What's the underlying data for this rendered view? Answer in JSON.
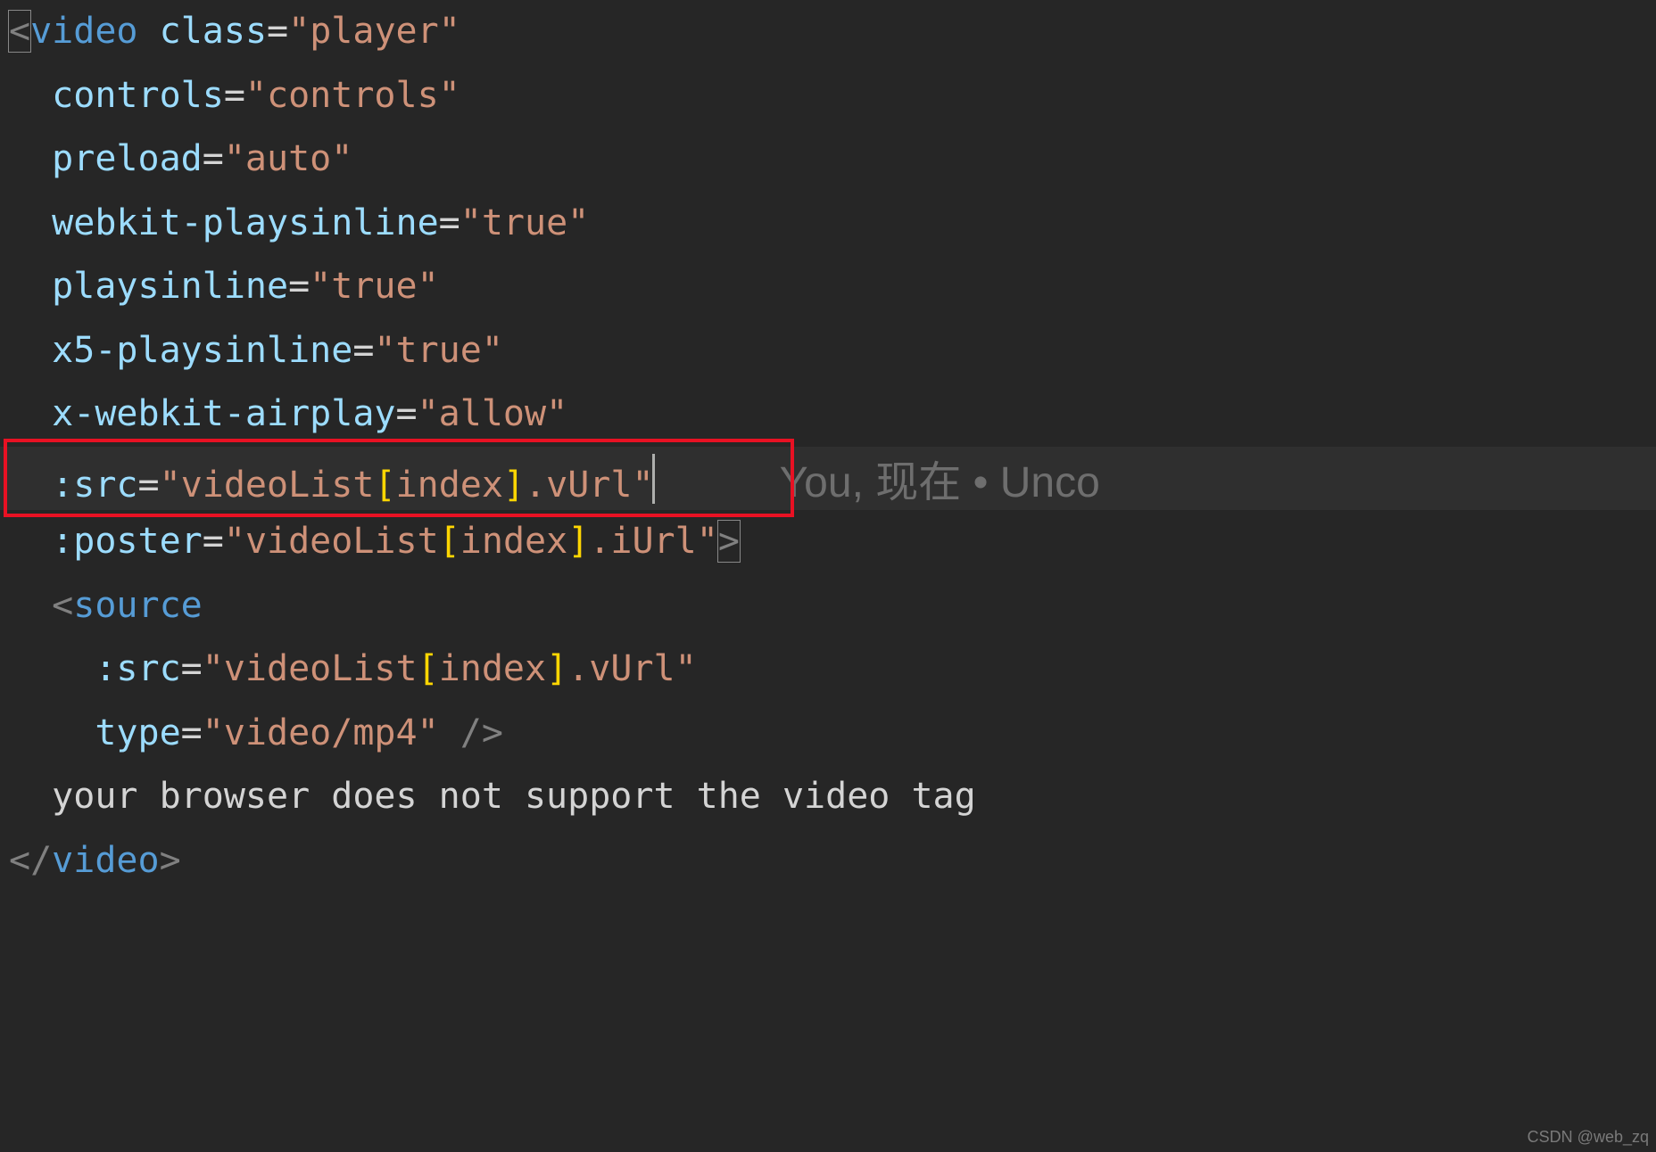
{
  "code": {
    "tag_open": "video",
    "tag_close": "video",
    "source_tag": "source",
    "attrs": {
      "class_name": "class",
      "class_val": "\"player\"",
      "controls_name": "controls",
      "controls_val": "\"controls\"",
      "preload_name": "preload",
      "preload_val": "\"auto\"",
      "wkplays_name": "webkit-playsinline",
      "wkplays_val": "\"true\"",
      "plays_name": "playsinline",
      "plays_val": "\"true\"",
      "x5plays_name": "x5-playsinline",
      "x5plays_val": "\"true\"",
      "airplay_name": "x-webkit-airplay",
      "airplay_val": "\"allow\"",
      "src_name": ":src",
      "src_q1": "\"",
      "src_ident": "videoList",
      "src_lb": "[",
      "src_index": "index",
      "src_rb": "]",
      "src_dot": ".vUrl",
      "src_q2": "\"",
      "poster_name": ":poster",
      "poster_q1": "\"",
      "poster_ident": "videoList",
      "poster_lb": "[",
      "poster_index": "index",
      "poster_rb": "]",
      "poster_dot": ".iUrl",
      "poster_q2": "\"",
      "source_src_name": ":src",
      "source_src_q1": "\"",
      "source_src_ident": "videoList",
      "source_src_lb": "[",
      "source_src_index": "index",
      "source_src_rb": "]",
      "source_src_dot": ".vUrl",
      "source_src_q2": "\"",
      "type_name": "type",
      "type_val": "\"video/mp4\""
    },
    "fallback_text": "your browser does not support the video tag"
  },
  "blame": {
    "author": "You",
    "sep1": ",",
    "when": "现在",
    "bullet": "•",
    "status": "Unco"
  },
  "punct": {
    "lt": "<",
    "gt": ">",
    "ltslash": "</",
    "slashgt": " />",
    "eq": "="
  },
  "watermark": "CSDN @web_zq"
}
